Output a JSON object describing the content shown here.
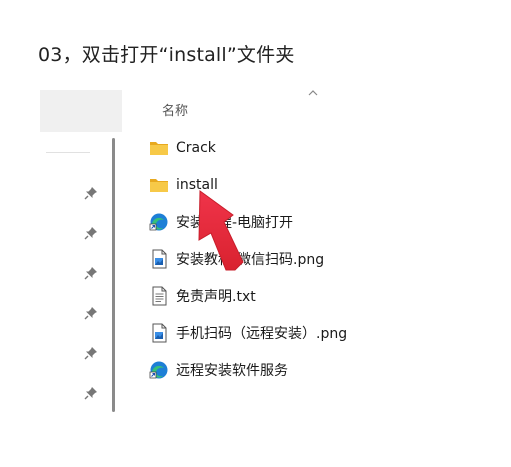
{
  "instruction": "03，双击打开“install”文件夹",
  "explorer": {
    "column_header": "名称",
    "files": [
      {
        "name": "Crack",
        "icon": "folder-icon"
      },
      {
        "name": "install",
        "icon": "folder-icon"
      },
      {
        "name": "安装教程-电脑打开",
        "icon": "edge-shortcut-icon"
      },
      {
        "name": "安装教程-微信扫码.png",
        "icon": "png-file-icon"
      },
      {
        "name": "免责声明.txt",
        "icon": "txt-file-icon"
      },
      {
        "name": "手机扫码（远程安装）.png",
        "icon": "png-file-icon"
      },
      {
        "name": "远程安装软件服务",
        "icon": "edge-shortcut-icon"
      }
    ]
  },
  "colors": {
    "folder": "#f5c33b",
    "arrow": "#e8303f",
    "edge_blue": "#1d7fd6",
    "edge_green": "#36c07a"
  }
}
